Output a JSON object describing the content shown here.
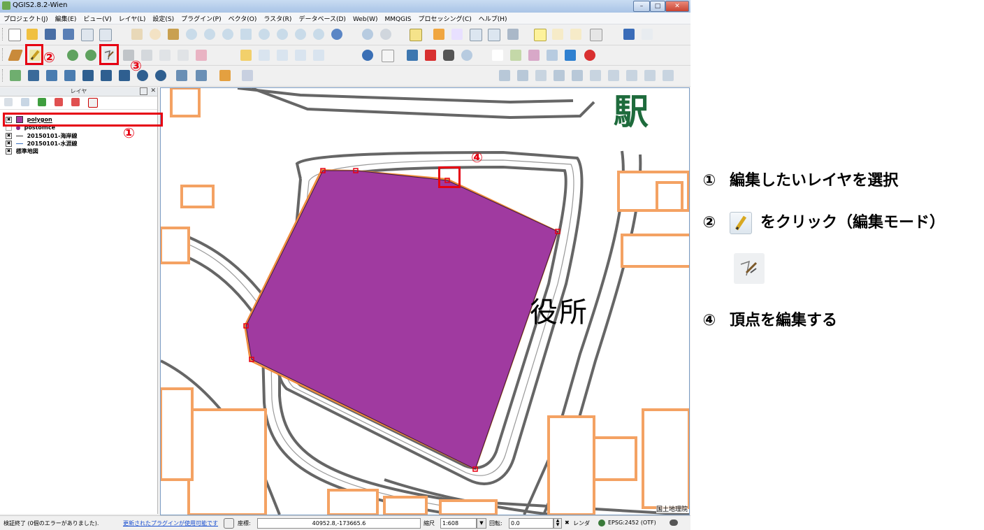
{
  "window": {
    "title": "QGIS2.8.2-Wien",
    "buttons": {
      "minimize": "–",
      "maximize": "□",
      "close": "✕"
    }
  },
  "menu": [
    "プロジェクト(J)",
    "編集(E)",
    "ビュー(V)",
    "レイヤ(L)",
    "設定(S)",
    "プラグイン(P)",
    "ベクタ(O)",
    "ラスタ(R)",
    "データベース(D)",
    "Web(W)",
    "MMQGIS",
    "プロセッシング(C)",
    "ヘルプ(H)"
  ],
  "layers_panel": {
    "title": "レイヤ",
    "layers": [
      {
        "name": "polygon",
        "checked": "✖",
        "symbol": "polygon-icon"
      },
      {
        "name": "postoffice",
        "checked": "",
        "symbol": "point-icon"
      },
      {
        "name": "20150101-海岸線",
        "checked": "✖",
        "symbol": "line-icon"
      },
      {
        "name": "20150101-水涯線",
        "checked": "✖",
        "symbol": "line-icon"
      },
      {
        "name": "標準地図",
        "checked": "✖",
        "symbol": "raster-icon"
      }
    ]
  },
  "map": {
    "label_station": "駅",
    "label_office": "役所",
    "attribution": "国土地理院"
  },
  "status": {
    "message": "検証終了 (0個のエラーがありました).",
    "plugin_link": "更新されたプラグインが使用可能です",
    "coord_label": "座標:",
    "coordinate": "40952.8,-173665.6",
    "scale_label": "縮尺",
    "scale": "1:608",
    "rotation_label": "回転:",
    "rotation": "0.0",
    "render_label": "レンダ",
    "crs": "EPSG:2452 (OTF)"
  },
  "callouts": {
    "n1": "①",
    "n2": "②",
    "n3": "③",
    "n4": "④"
  },
  "annotations": [
    {
      "num": "①",
      "text": "編集したいレイヤを選択"
    },
    {
      "num": "②",
      "text": "をクリック（編集モード）"
    },
    {
      "num": "④",
      "text": "頂点を編集する"
    }
  ],
  "colors": {
    "polygon_fill": "#a03aa0",
    "building_orange": "#f4a263",
    "callout_red": "#e60012",
    "station_text": "#1e6b3c"
  }
}
